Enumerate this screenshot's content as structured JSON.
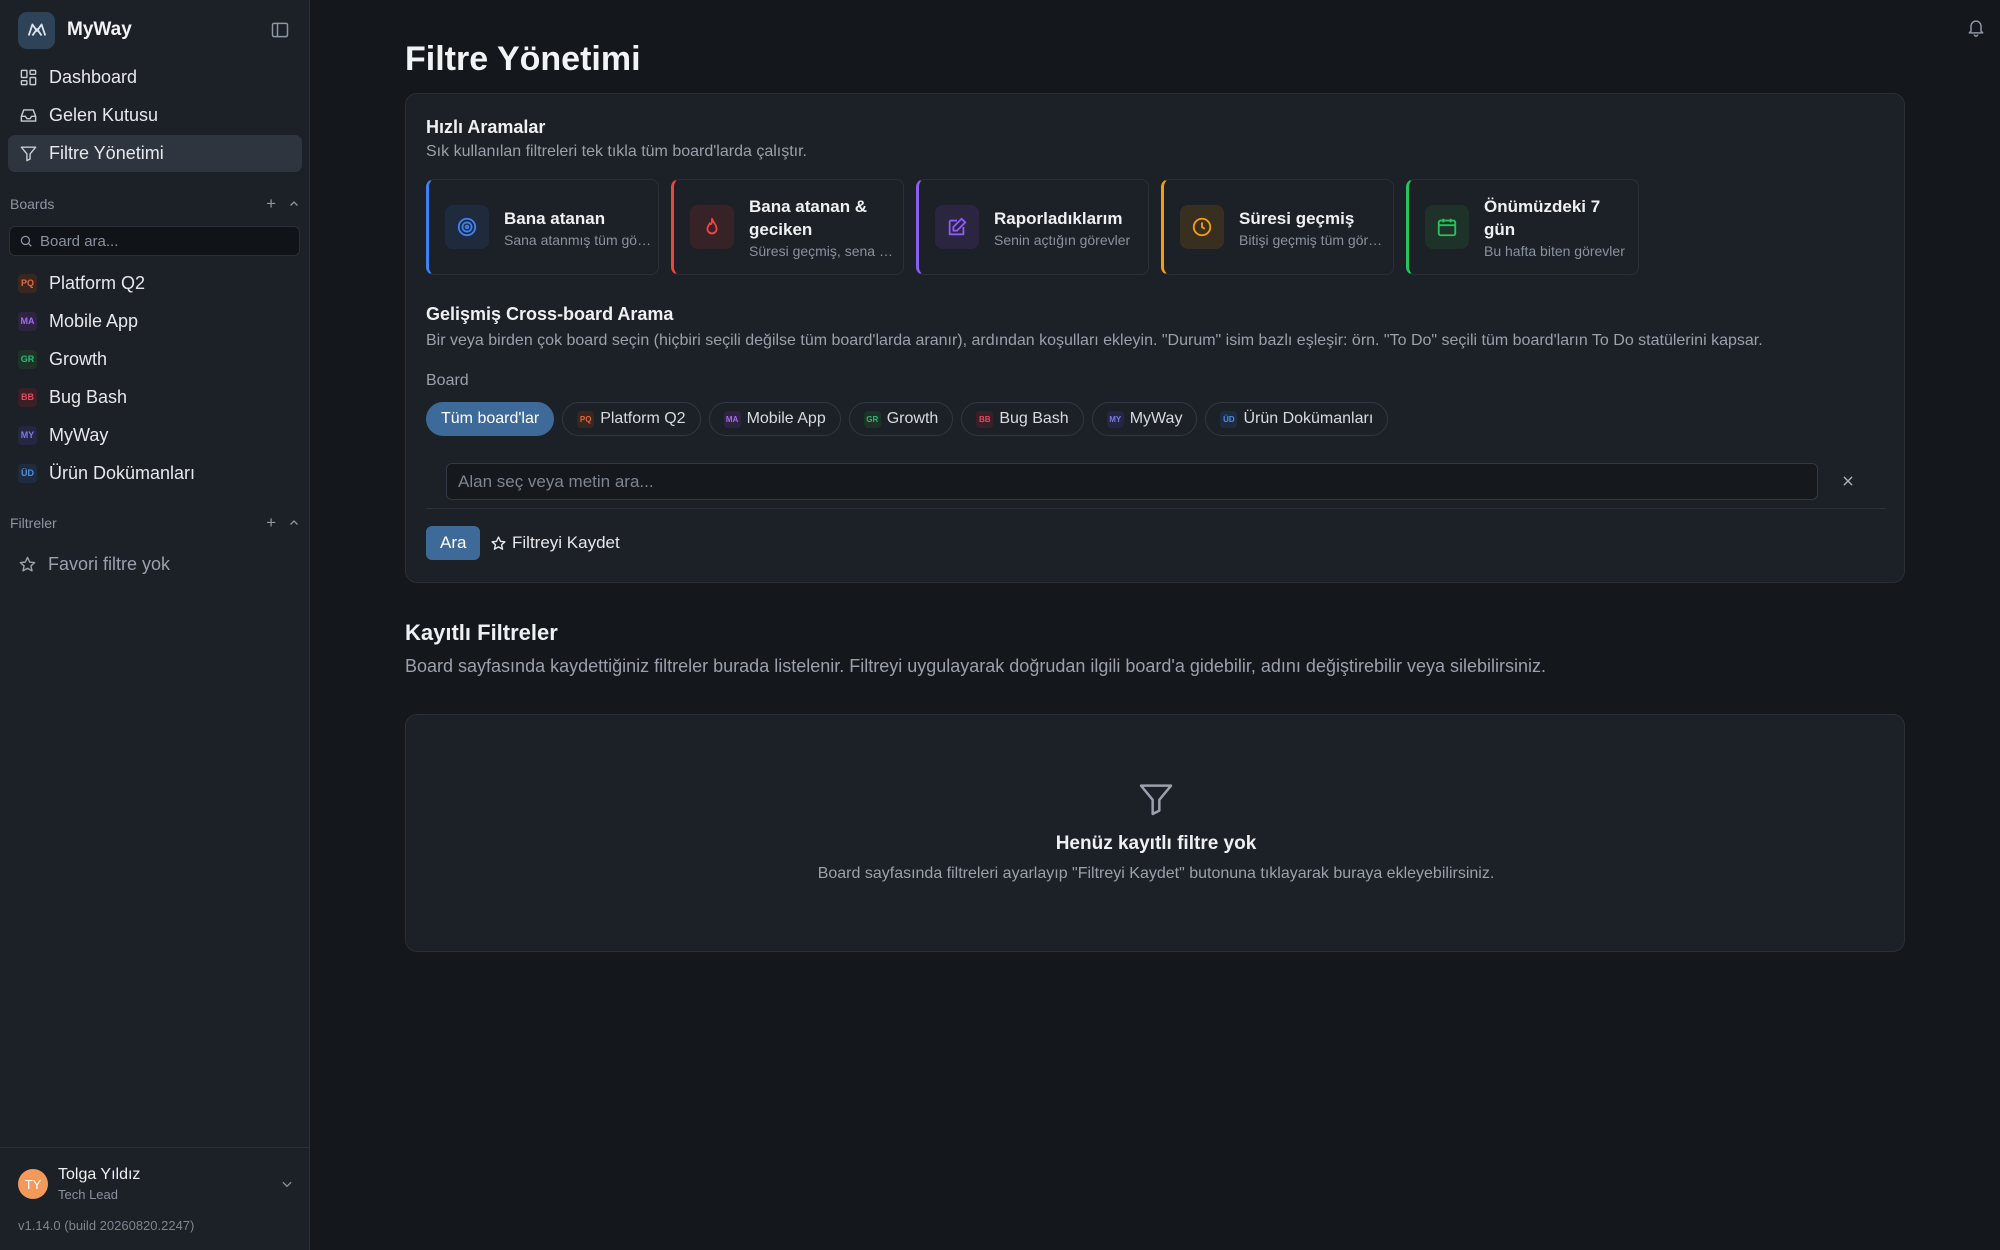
{
  "app": {
    "name": "MyWay"
  },
  "sidebar": {
    "nav": [
      {
        "label": "Dashboard",
        "icon": "dashboard-icon"
      },
      {
        "label": "Gelen Kutusu",
        "icon": "inbox-icon"
      },
      {
        "label": "Filtre Yönetimi",
        "icon": "filter-icon",
        "active": true
      }
    ],
    "boards_heading": "Boards",
    "board_search_placeholder": "Board ara...",
    "boards": [
      {
        "abbr": "PQ",
        "label": "Platform Q2",
        "color": "#e36a3c",
        "bg": "#3a2620"
      },
      {
        "abbr": "MA",
        "label": "Mobile App",
        "color": "#a56bf0",
        "bg": "#2e2440"
      },
      {
        "abbr": "GR",
        "label": "Growth",
        "color": "#2fb87a",
        "bg": "#1d3328"
      },
      {
        "abbr": "BB",
        "label": "Bug Bash",
        "color": "#e5485f",
        "bg": "#3a2026"
      },
      {
        "abbr": "MY",
        "label": "MyWay",
        "color": "#7b79f0",
        "bg": "#25263f"
      },
      {
        "abbr": "ÜD",
        "label": "Ürün Dokümanları",
        "color": "#4f8fe8",
        "bg": "#1f2c40"
      }
    ],
    "filters_heading": "Filtreler",
    "favorites_empty": "Favori filtre yok",
    "user": {
      "initials": "TY",
      "name": "Tolga Yıldız",
      "role": "Tech Lead"
    },
    "version": "v1.14.0 (build 20260820.2247)"
  },
  "main": {
    "title": "Filtre Yönetimi",
    "quick": {
      "title": "Hızlı Aramalar",
      "subtitle": "Sık kullanılan filtreleri tek tıkla tüm board'larda çalıştır.",
      "items": [
        {
          "title": "Bana atanan",
          "desc": "Sana atanmış tüm görevler",
          "accent": "#3b82f6",
          "icon": "target-icon"
        },
        {
          "title": "Bana atanan & geciken",
          "desc": "Süresi geçmiş, sena atanmış",
          "accent": "#ef4444",
          "icon": "flame-icon"
        },
        {
          "title": "Raporladıklarım",
          "desc": "Senin açtığın görevler",
          "accent": "#8b5cf6",
          "icon": "edit-icon"
        },
        {
          "title": "Süresi geçmiş",
          "desc": "Bitişi geçmiş tüm görevler",
          "accent": "#f59e0b",
          "icon": "clock-icon"
        },
        {
          "title": "Önümüzdeki 7 gün",
          "desc": "Bu hafta biten görevler",
          "accent": "#22c55e",
          "icon": "calendar-icon"
        }
      ]
    },
    "advanced": {
      "title": "Gelişmiş Cross-board Arama",
      "subtitle": "Bir veya birden çok board seçin (hiçbiri seçili değilse tüm board'larda aranır), ardından koşulları ekleyin. \"Durum\" isim bazlı eşleşir: örn. \"To Do\" seçili tüm board'ların To Do statülerini kapsar.",
      "board_label": "Board",
      "all_boards_chip": "Tüm board'lar",
      "field_placeholder": "Alan seç veya metin ara...",
      "search_button": "Ara",
      "save_button": "Filtreyi Kaydet"
    },
    "saved": {
      "title": "Kayıtlı Filtreler",
      "subtitle": "Board sayfasında kaydettiğiniz filtreler burada listelenir. Filtreyi uygulayarak doğrudan ilgili board'a gidebilir, adını değiştirebilir veya silebilirsiniz.",
      "empty_title": "Henüz kayıtlı filtre yok",
      "empty_subtitle": "Board sayfasında filtreleri ayarlayıp \"Filtreyi Kaydet\" butonuna tıklayarak buraya ekleyebilirsiniz."
    }
  }
}
